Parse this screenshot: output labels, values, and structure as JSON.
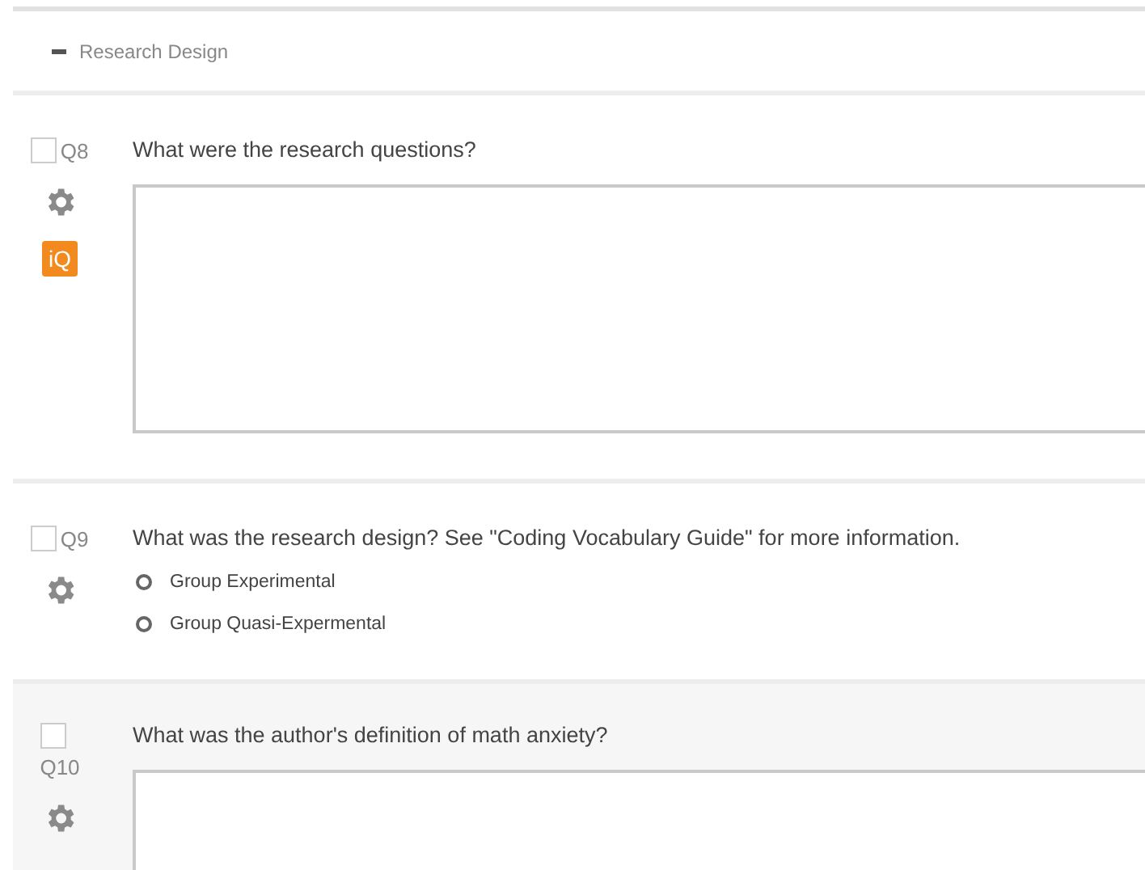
{
  "block": {
    "title": "Research Design",
    "expanded": true
  },
  "questions": [
    {
      "number": "Q8",
      "kind": "text",
      "text": "What were the research questions?",
      "checked": false,
      "highlighted": false,
      "badge": "iQ"
    },
    {
      "number": "Q9",
      "kind": "choice",
      "text": "What was the research design? See \"Coding Vocabulary Guide\" for more information.",
      "checked": false,
      "highlighted": false,
      "options": [
        {
          "label": "Group Experimental",
          "selected": false
        },
        {
          "label": "Group Quasi-Expermental",
          "selected": false
        }
      ]
    },
    {
      "number": "Q10",
      "kind": "text",
      "text": "What was the author's definition of math anxiety?",
      "checked": false,
      "highlighted": true
    }
  ]
}
